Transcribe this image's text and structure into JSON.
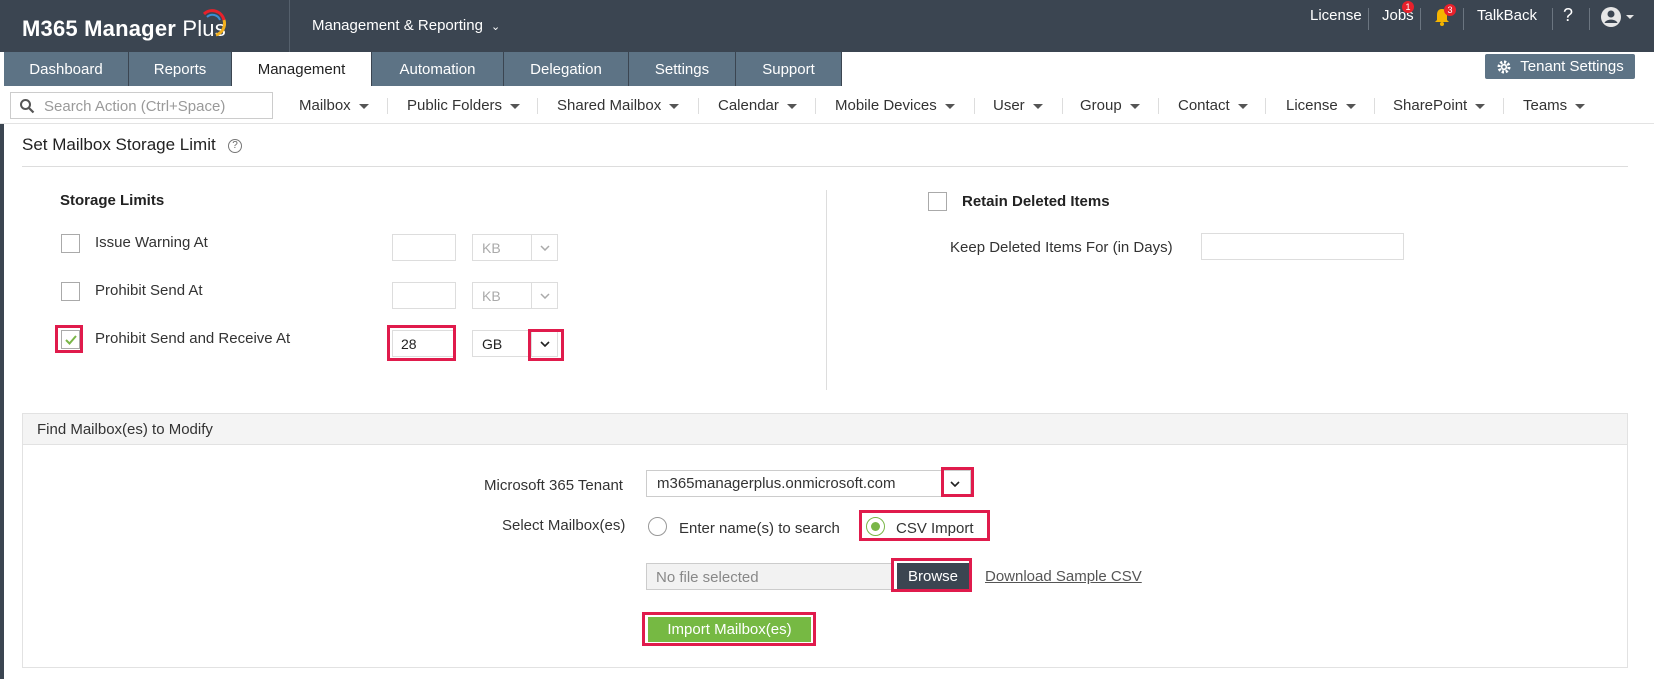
{
  "app": {
    "logo_text": "M365 Manager",
    "logo_plus": "Plus",
    "section_switcher": "Management & Reporting"
  },
  "topnav": {
    "license": "License",
    "jobs": "Jobs",
    "jobs_badge": "1",
    "alerts_badge": "3",
    "talkback": "TalkBack",
    "help": "?"
  },
  "tabs": [
    {
      "label": "Dashboard"
    },
    {
      "label": "Reports"
    },
    {
      "label": "Management"
    },
    {
      "label": "Automation"
    },
    {
      "label": "Delegation"
    },
    {
      "label": "Settings"
    },
    {
      "label": "Support"
    }
  ],
  "active_tab": "Management",
  "tenant_settings": "Tenant Settings",
  "search": {
    "placeholder": "Search Action (Ctrl+Space)"
  },
  "action_menu": [
    {
      "label": "Mailbox"
    },
    {
      "label": "Public Folders"
    },
    {
      "label": "Shared Mailbox"
    },
    {
      "label": "Calendar"
    },
    {
      "label": "Mobile Devices"
    },
    {
      "label": "User"
    },
    {
      "label": "Group"
    },
    {
      "label": "Contact"
    },
    {
      "label": "License"
    },
    {
      "label": "SharePoint"
    },
    {
      "label": "Teams"
    }
  ],
  "page": {
    "title": "Set Mailbox Storage Limit",
    "help_glyph": "?"
  },
  "storage": {
    "heading": "Storage Limits",
    "rows": [
      {
        "label": "Issue Warning At",
        "checked": false,
        "value": "",
        "unit": "KB"
      },
      {
        "label": "Prohibit Send At",
        "checked": false,
        "value": "",
        "unit": "KB"
      },
      {
        "label": "Prohibit Send and Receive At",
        "checked": true,
        "value": "28",
        "unit": "GB"
      }
    ]
  },
  "retain": {
    "heading": "Retain Deleted Items",
    "checked": false,
    "keep_label": "Keep Deleted Items For (in Days)",
    "keep_value": ""
  },
  "find": {
    "heading": "Find Mailbox(es) to Modify",
    "tenant_label": "Microsoft 365 Tenant",
    "tenant_value": "m365managerplus.onmicrosoft.com",
    "select_label": "Select Mailbox(es)",
    "option_search": "Enter name(s) to search",
    "option_csv": "CSV Import",
    "selected_option": "CSV Import",
    "file_placeholder": "No file selected",
    "browse": "Browse",
    "sample_link": "Download Sample CSV",
    "import_button": "Import Mailbox(es)"
  },
  "colors": {
    "topbar": "#3b4551",
    "tab": "#5d7385",
    "highlight": "#e01b4c",
    "accent_green": "#76b943"
  }
}
